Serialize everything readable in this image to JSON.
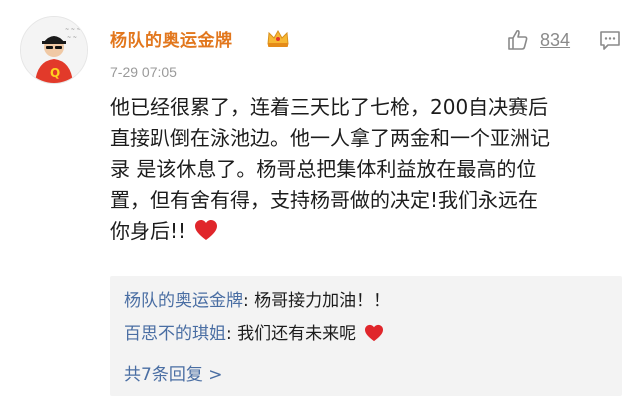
{
  "comment": {
    "author": "杨队的奥运金牌",
    "badge_icon": "crown-badge-icon",
    "timestamp": "7-29 07:05",
    "like_count": "834",
    "body_lines": [
      "他已经很累了，连着三天比了七枪，200自决赛后",
      "直接趴倒在泳池边。他一人拿了两金和一个亚洲记",
      "录 是该休息了。杨哥总把集体利益放在最高的位",
      "置，但有舍有得，支持杨哥做的决定!我们永远在",
      "你身后!!"
    ],
    "body_end_icon": "red-heart-icon"
  },
  "replies": [
    {
      "name": "杨队的奥运金牌",
      "text": ": 杨哥接力加油！！"
    },
    {
      "name": "百思不的琪姐",
      "text": ": 我们还有未来呢",
      "end_icon": "red-heart-icon"
    }
  ],
  "more_replies": "共7条回复 >",
  "colors": {
    "author": "#e2771d",
    "reply_name": "#4a6ea3",
    "heart": "#e0262b",
    "reply_bg": "#f3f3f3"
  }
}
